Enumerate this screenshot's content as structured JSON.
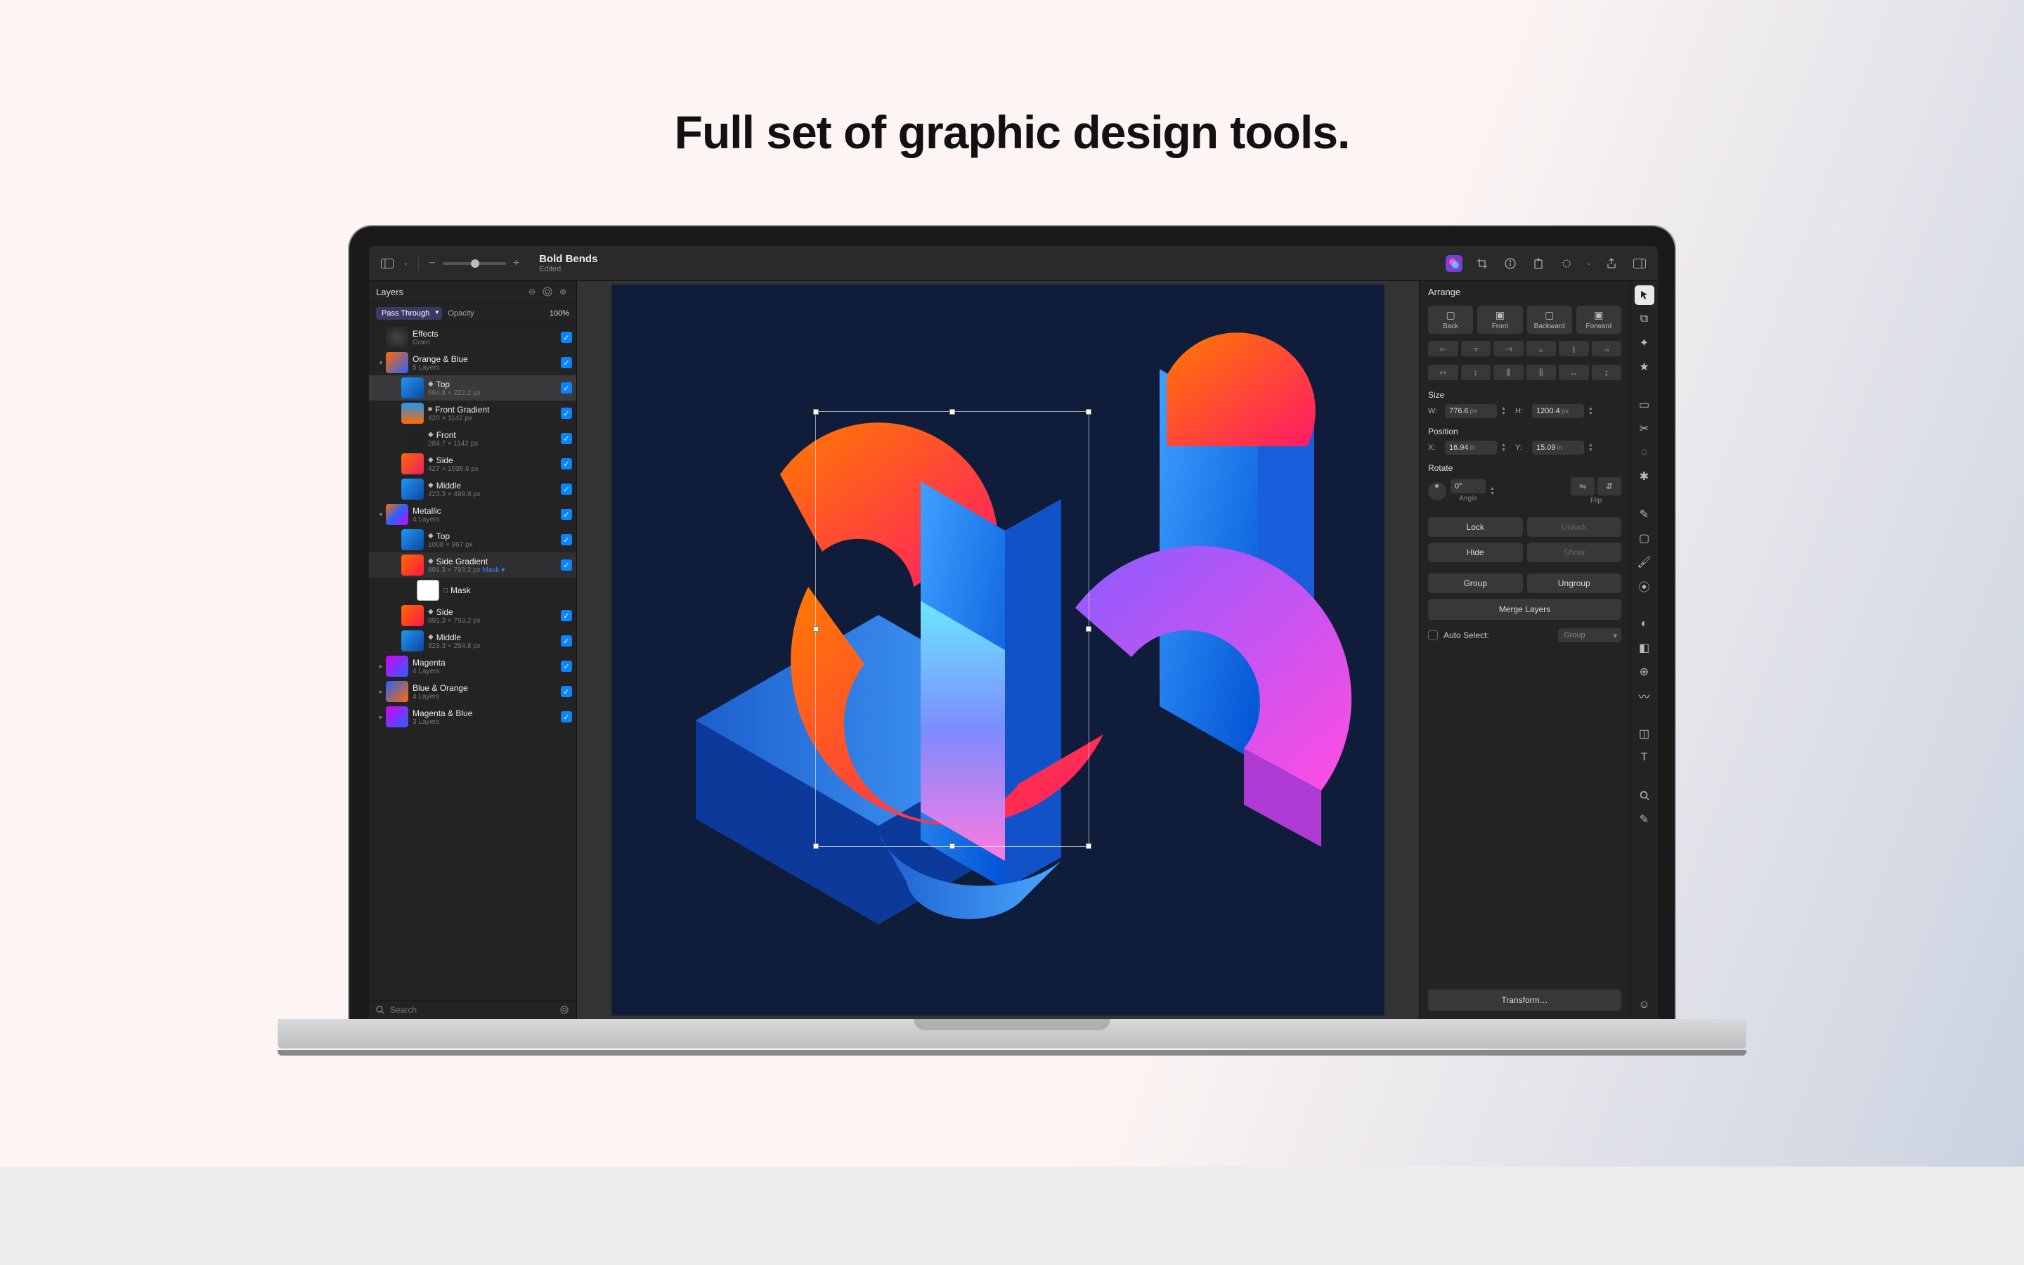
{
  "headline": "Full set of graphic design tools.",
  "document": {
    "title": "Bold Bends",
    "subtitle": "Edited"
  },
  "layersPanel": {
    "title": "Layers",
    "blendMode": "Pass Through",
    "opacityLabel": "Opacity",
    "opacityValue": "100%",
    "searchPlaceholder": "Search"
  },
  "layers": [
    {
      "name": "Effects",
      "sub": "Grain",
      "indent": 0,
      "thumb": "grain",
      "disclosure": "",
      "selected": false
    },
    {
      "name": "Orange & Blue",
      "sub": "5 Layers",
      "indent": 0,
      "thumb": "ob",
      "disclosure": "▾",
      "selected": false
    },
    {
      "name": "Top",
      "sub": "564.8 × 222.2 px",
      "indent": 1,
      "thumb": "top1",
      "disclosure": "",
      "shape": "◆",
      "selected": true
    },
    {
      "name": "Front Gradient",
      "sub": "420 × 1142 px",
      "indent": 1,
      "thumb": "fg",
      "disclosure": "",
      "shape": "■",
      "selected": false
    },
    {
      "name": "Front",
      "sub": "284.7 × 1142 px",
      "indent": 1,
      "thumb": "front",
      "disclosure": "",
      "shape": "◆",
      "selected": false
    },
    {
      "name": "Side",
      "sub": "427 × 1036.6 px",
      "indent": 1,
      "thumb": "side1",
      "disclosure": "",
      "shape": "◆",
      "selected": false
    },
    {
      "name": "Middle",
      "sub": "423.3 × 499.8 px",
      "indent": 1,
      "thumb": "mid1",
      "disclosure": "",
      "shape": "◆",
      "selected": false
    },
    {
      "name": "Metallic",
      "sub": "4 Layers",
      "indent": 0,
      "thumb": "met",
      "disclosure": "▾",
      "selected": false
    },
    {
      "name": "Top",
      "sub": "1008 × 967 px",
      "indent": 1,
      "thumb": "top2",
      "disclosure": "",
      "shape": "◆",
      "selected": false
    },
    {
      "name": "Side Gradient",
      "sub": "",
      "indent": 1,
      "thumb": "sg",
      "disclosure": "",
      "shape": "◆",
      "selected": false,
      "subDims": "891.3 × 793.2 px",
      "maskTag": "Mask ▾"
    },
    {
      "name": "Mask",
      "sub": "",
      "indent": 2,
      "thumb": "mask",
      "disclosure": "",
      "shape": "□",
      "selected": false,
      "noCheck": true
    },
    {
      "name": "Side",
      "sub": "891.3 × 793.2 px",
      "indent": 1,
      "thumb": "side2",
      "disclosure": "",
      "shape": "◆",
      "selected": false
    },
    {
      "name": "Middle",
      "sub": "323.3 × 254.8 px",
      "indent": 1,
      "thumb": "mid2",
      "disclosure": "",
      "shape": "◆",
      "selected": false
    },
    {
      "name": "Magenta",
      "sub": "4 Layers",
      "indent": 0,
      "thumb": "mag",
      "disclosure": "▸",
      "selected": false
    },
    {
      "name": "Blue & Orange",
      "sub": "4 Layers",
      "indent": 0,
      "thumb": "bo",
      "disclosure": "▸",
      "selected": false
    },
    {
      "name": "Magenta & Blue",
      "sub": "3 Layers",
      "indent": 0,
      "thumb": "mb",
      "disclosure": "▸",
      "selected": false
    }
  ],
  "arrange": {
    "title": "Arrange",
    "orderButtons": [
      "Back",
      "Front",
      "Backward",
      "Forward"
    ],
    "sizeLabel": "Size",
    "width": "776.6",
    "widthUnit": "px",
    "height": "1200.4",
    "heightUnit": "px",
    "positionLabel": "Position",
    "x": "16.94",
    "xUnit": "in",
    "y": "15.09",
    "yUnit": "in",
    "rotateLabel": "Rotate",
    "angle": "0°",
    "angleLabel": "Angle",
    "flipLabel": "Flip",
    "lock": "Lock",
    "unlock": "Unlock",
    "hide": "Hide",
    "show": "Show",
    "group": "Group",
    "ungroup": "Ungroup",
    "merge": "Merge Layers",
    "autoSelectLabel": "Auto Select:",
    "autoSelectValue": "Group",
    "transform": "Transform…"
  },
  "thumbs": {
    "grain": "background:radial-gradient(#444,#222)",
    "ob": "background:linear-gradient(135deg,#ff6a00,#2962ff)",
    "top1": "background:linear-gradient(135deg,#2196f3,#0d47a1)",
    "fg": "background:linear-gradient(#2196f3,#ff6a00)",
    "front": "background:#222;color:#ddd",
    "side1": "background:linear-gradient(135deg,#ff6a00,#e91e63)",
    "mid1": "background:linear-gradient(135deg,#2196f3,#0d47a1)",
    "met": "background:linear-gradient(135deg,#ff6a00,#2962ff,#d500f9)",
    "top2": "background:linear-gradient(135deg,#2196f3,#0d47a1)",
    "sg": "background:linear-gradient(135deg,#ff6a00,#ff1744)",
    "mask": "background:#fff;border:1px solid #aaa",
    "side2": "background:linear-gradient(135deg,#ff6a00,#ff1744)",
    "mid2": "background:linear-gradient(135deg,#2196f3,#0d47a1)",
    "mag": "background:linear-gradient(135deg,#d500f9,#2962ff)",
    "bo": "background:linear-gradient(135deg,#2962ff,#ff6a00)",
    "mb": "background:linear-gradient(135deg,#d500f9,#2962ff)"
  }
}
